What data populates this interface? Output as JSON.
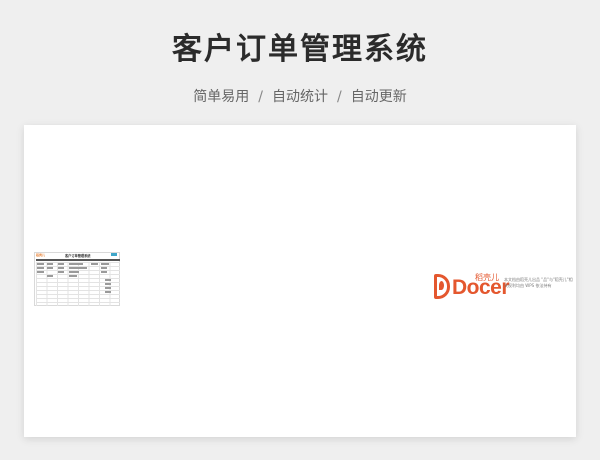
{
  "page": {
    "title": "客户订单管理系统",
    "subtitle_parts": [
      "简单易用",
      "自动统计",
      "自动更新"
    ],
    "separator": "/"
  },
  "preview": {
    "brand": "稻壳儿",
    "table_title": "客户订单管理系统"
  },
  "watermark": {
    "logo_text": "Docer",
    "logo_cn": "稻壳儿",
    "description": "本文档由稻壳儿出品 \"品\"与\"稻壳儿\"相关权利均由 WPS 依法持有"
  },
  "colors": {
    "title": "#2b2b2b",
    "brand_orange": "#e4572e",
    "accent_blue": "#3fa6c9",
    "background": "#efefef"
  }
}
